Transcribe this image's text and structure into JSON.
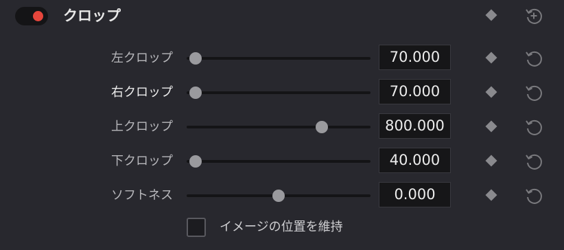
{
  "section": {
    "title": "クロップ",
    "enabled": true,
    "accent_color": "#e6463c"
  },
  "icons": {
    "keyframe": "keyframe-diamond-icon",
    "reset": "reset-icon",
    "add_reset": "reset-add-icon"
  },
  "rows": [
    {
      "label": "左クロップ",
      "value": "70.000",
      "slider_fraction": 0.05
    },
    {
      "label": "右クロップ",
      "value": "70.000",
      "slider_fraction": 0.05
    },
    {
      "label": "上クロップ",
      "value": "800.000",
      "slider_fraction": 0.735
    },
    {
      "label": "下クロップ",
      "value": "40.000",
      "slider_fraction": 0.05
    },
    {
      "label": "ソフトネス",
      "value": "0.000",
      "slider_fraction": 0.5
    }
  ],
  "retain_image_position": {
    "label": "イメージの位置を維持",
    "checked": false
  }
}
